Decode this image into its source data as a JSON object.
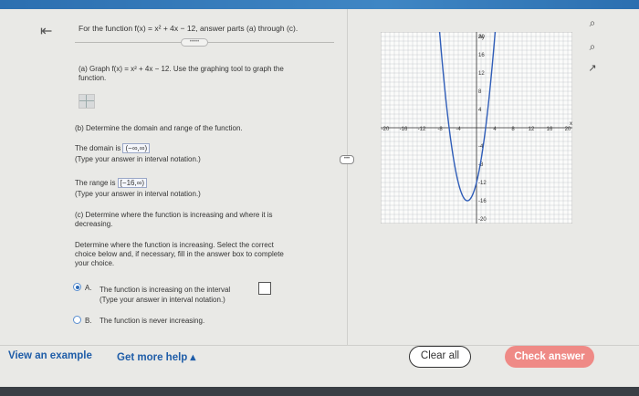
{
  "question": {
    "title": "For the function f(x) = x² + 4x − 12, answer parts (a) through (c).",
    "dots": "•••••"
  },
  "part_a": {
    "text": "(a) Graph f(x) = x² + 4x − 12. Use the graphing tool to graph the",
    "text2": "function."
  },
  "part_b": {
    "heading": "(b) Determine the domain and range of the function.",
    "domain_prefix": "The domain is",
    "domain_value": "(−∞,∞)",
    "domain_hint": "(Type your answer in interval notation.)",
    "range_prefix": "The range is",
    "range_value": "[−16,∞)",
    "range_hint": "(Type your answer in interval notation.)"
  },
  "part_c": {
    "heading1": "(c) Determine where the function is increasing and where it is",
    "heading2": "decreasing.",
    "instr1": "Determine where the function is increasing. Select the correct",
    "instr2": "choice below and, if necessary, fill in the answer box to complete",
    "instr3": "your choice.",
    "option_a_letter": "A.",
    "option_a_text": "The function is increasing on the interval",
    "option_a_hint": "(Type your answer in interval notation.)",
    "option_b_letter": "B.",
    "option_b_text": "The function is never increasing."
  },
  "graph": {
    "x_label": "x",
    "y_label": "Ay",
    "x_ticks": [
      "-20",
      "-16",
      "-12",
      "-8",
      "-4",
      "4",
      "8",
      "12",
      "16",
      "20"
    ],
    "y_ticks": [
      "20",
      "16",
      "12",
      "8",
      "4",
      "-4",
      "-8",
      "-12",
      "-16",
      "-20"
    ],
    "xlim": [
      -21,
      21
    ],
    "ylim": [
      -21,
      21
    ],
    "curve_color": "#2f5db8"
  },
  "side_icons": [
    "zoom-in-icon",
    "zoom-out-icon",
    "external-link-icon"
  ],
  "footer": {
    "view_example": "View an example",
    "get_more_help": "Get more help ▴",
    "clear_all": "Clear all",
    "check_answer": "Check answer"
  },
  "colors": {
    "accent": "#1f5da8",
    "check": "#ef8a86"
  }
}
